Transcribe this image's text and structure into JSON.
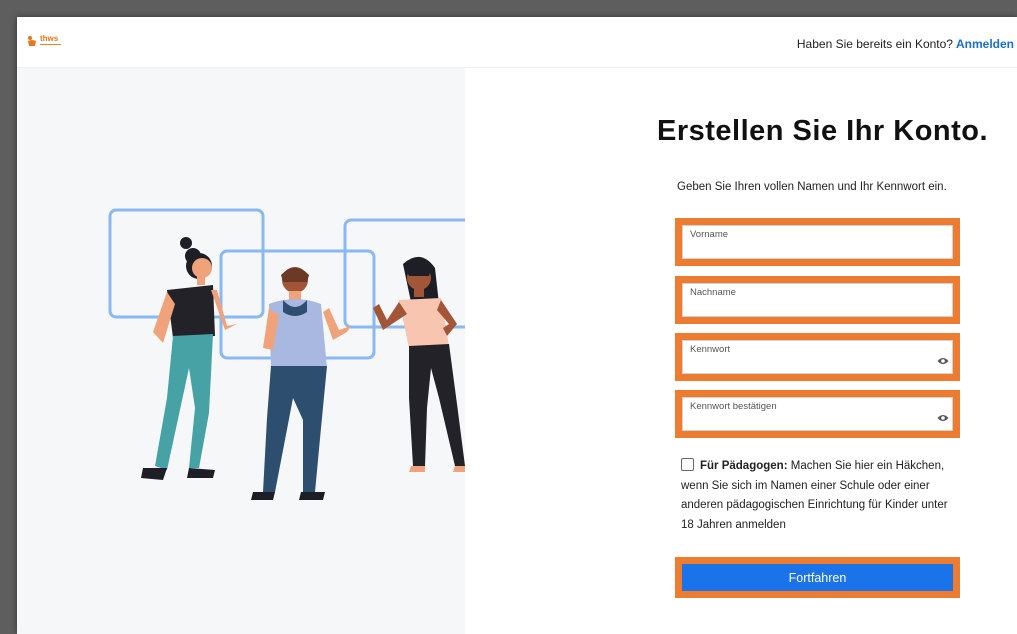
{
  "header": {
    "logo_text": "thws",
    "signin_prompt": "Haben Sie bereits ein Konto?",
    "signin_link": "Anmelden"
  },
  "form": {
    "title": "Erstellen Sie Ihr Konto.",
    "subtitle": "Geben Sie Ihren vollen Namen und Ihr Kennwort ein.",
    "fields": [
      {
        "label": "Vorname",
        "value": ""
      },
      {
        "label": "Nachname",
        "value": ""
      },
      {
        "label": "Kennwort",
        "value": ""
      },
      {
        "label": "Kennwort bestätigen",
        "value": ""
      }
    ],
    "educator_bold": "Für Pädagogen:",
    "educator_text": "Machen Sie hier ein Häkchen, wenn Sie sich im Namen einer Schule oder einer anderen pädagogischen Einrichtung für Kinder unter 18 Jahren anmelden",
    "educator_checked": false,
    "submit_label": "Fortfahren"
  },
  "icons": {
    "logo": "thws-logo-icon",
    "show_password": "eye-icon"
  },
  "colors": {
    "accent": "#1a73e8",
    "highlight": "#ed7c31",
    "logo": "#e8771e",
    "panel": "#f6f7f9"
  }
}
